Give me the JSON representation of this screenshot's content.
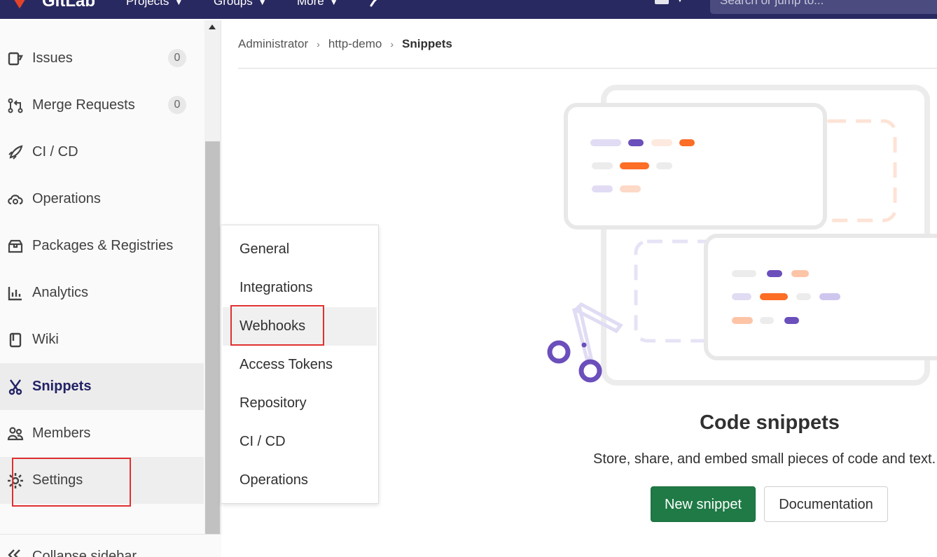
{
  "topbar": {
    "brand": "GitLab",
    "nav": [
      {
        "label": "Projects"
      },
      {
        "label": "Groups"
      },
      {
        "label": "More"
      }
    ],
    "search_placeholder": "Search or jump to..."
  },
  "sidebar": {
    "items": [
      {
        "label": "Issues",
        "count": "0",
        "icon": "issues-icon"
      },
      {
        "label": "Merge Requests",
        "count": "0",
        "icon": "merge-request-icon"
      },
      {
        "label": "CI / CD",
        "icon": "rocket-icon"
      },
      {
        "label": "Operations",
        "icon": "cloud-gear-icon"
      },
      {
        "label": "Packages & Registries",
        "icon": "package-icon"
      },
      {
        "label": "Analytics",
        "icon": "chart-icon"
      },
      {
        "label": "Wiki",
        "icon": "book-icon"
      },
      {
        "label": "Snippets",
        "icon": "scissors-icon",
        "active": true
      },
      {
        "label": "Members",
        "icon": "users-icon"
      },
      {
        "label": "Settings",
        "icon": "gear-icon",
        "highlighted": true
      }
    ],
    "collapse_label": "Collapse sidebar"
  },
  "settings_flyout": {
    "items": [
      "General",
      "Integrations",
      "Webhooks",
      "Access Tokens",
      "Repository",
      "CI / CD",
      "Operations"
    ],
    "hovered": "Webhooks"
  },
  "breadcrumb": {
    "items": [
      "Administrator",
      "http-demo"
    ],
    "current": "Snippets"
  },
  "empty_state": {
    "title": "Code snippets",
    "description": "Store, share, and embed small pieces of code and text.",
    "primary_button": "New snippet",
    "secondary_button": "Documentation"
  },
  "colors": {
    "navbar": "#292961",
    "primary_button": "#1f7a45",
    "annotation_red": "#e03030",
    "accent_purple": "#6b4fbb",
    "accent_orange": "#fc6d26"
  }
}
